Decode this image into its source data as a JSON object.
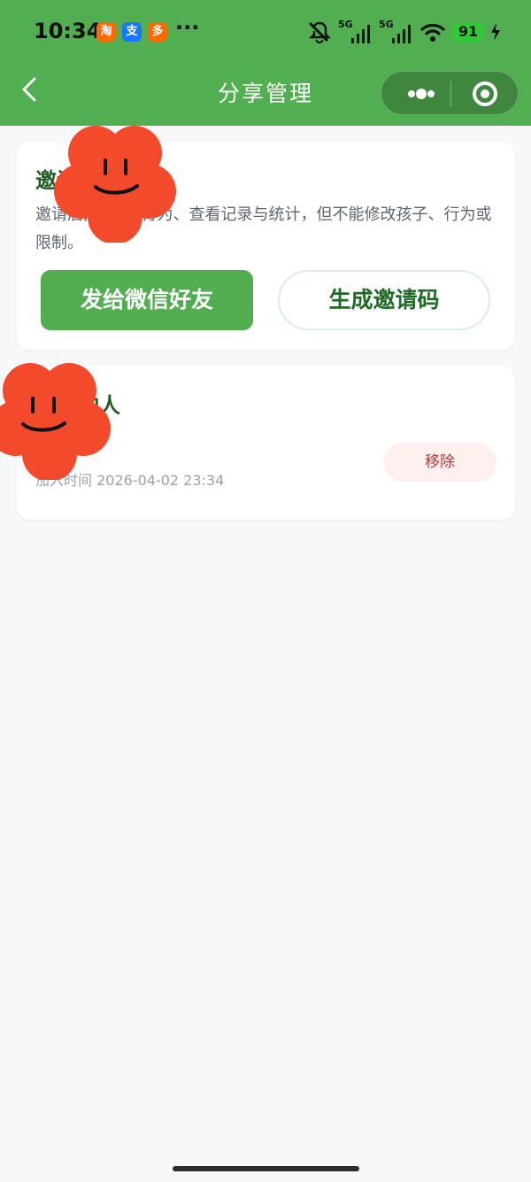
{
  "status_bar": {
    "time": "10:34",
    "apps": [
      "淘",
      "支",
      "多"
    ],
    "more": "···",
    "signal_1": "5G",
    "signal_2": "5G",
    "battery": "91"
  },
  "header": {
    "title": "分享管理",
    "back_icon": "back-chevron-icon",
    "menu_icon": "more-dots-icon",
    "close_icon": "target-close-icon",
    "background": "#52af51"
  },
  "invite_card": {
    "title": "邀请      监护人",
    "description": "邀请后,      可记录行为、查看记录与统计，但不能修改孩子、行为或限制。",
    "wechat_button": "发给微信好友",
    "code_button": "生成邀请码"
  },
  "guardians_card": {
    "title": "      的监护人",
    "join_time": "加入时间 2026-04-02 23:34",
    "remove_button": "移除"
  },
  "colors": {
    "accent": "#51ad50",
    "title_green": "#1f5d25",
    "remove_bg": "#fff0f0",
    "remove_text": "#b83737",
    "page_bg": "#f7f8fa"
  }
}
